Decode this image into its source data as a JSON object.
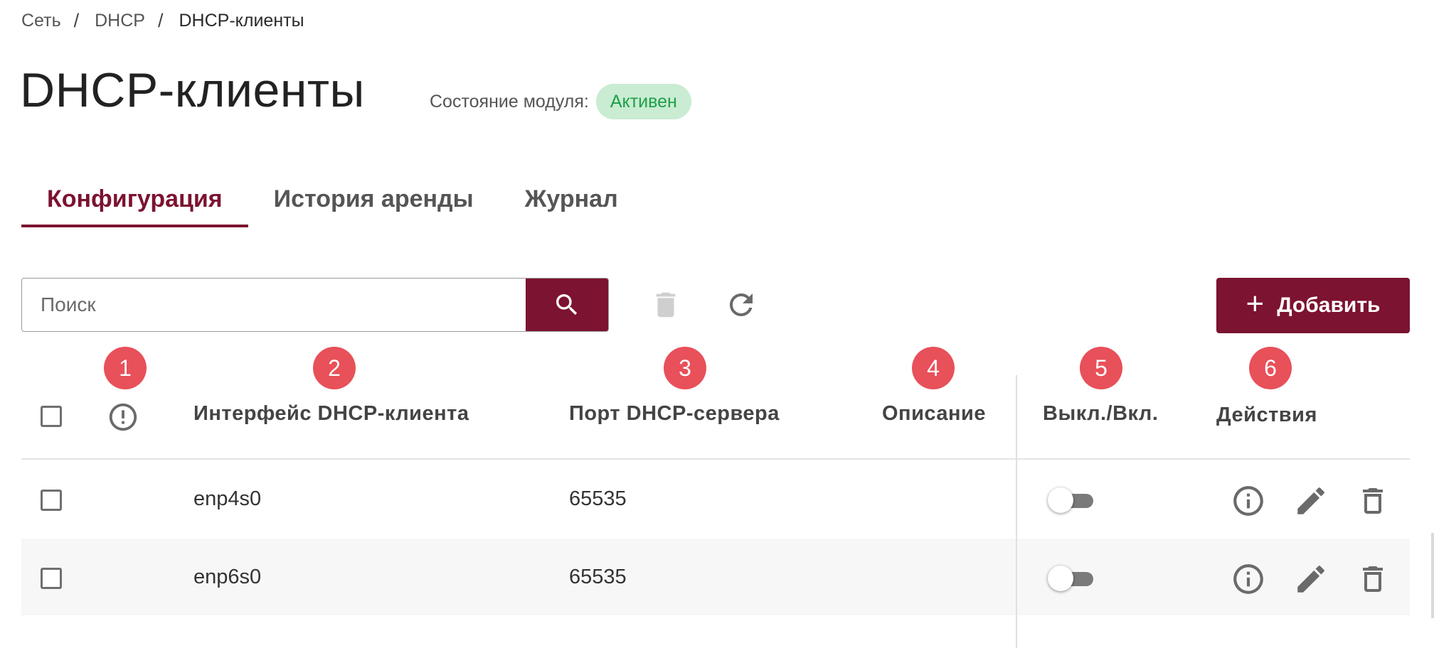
{
  "breadcrumb": {
    "items": [
      "Сеть",
      "DHCP",
      "DHCP-клиенты"
    ],
    "separator": "/"
  },
  "page": {
    "title": "DHCP-клиенты",
    "module_state_label": "Состояние модуля:",
    "module_state_value": "Активен"
  },
  "tabs": [
    {
      "label": "Конфигурация",
      "active": true
    },
    {
      "label": "История аренды",
      "active": false
    },
    {
      "label": "Журнал",
      "active": false
    }
  ],
  "toolbar": {
    "search_placeholder": "Поиск",
    "add_label": "Добавить",
    "search_icon": "search-icon",
    "delete_icon": "trash-icon",
    "refresh_icon": "refresh-icon"
  },
  "markers": [
    "1",
    "2",
    "3",
    "4",
    "5",
    "6"
  ],
  "table": {
    "columns": {
      "status_icon": "alert-circle-icon",
      "interface": "Интерфейс DHCP-клиента",
      "port": "Порт DHCP-сервера",
      "description": "Описание",
      "toggle": "Выкл./Вкл.",
      "actions": "Действия"
    },
    "rows": [
      {
        "interface": "enp4s0",
        "port": "65535",
        "description": "",
        "enabled": false
      },
      {
        "interface": "enp6s0",
        "port": "65535",
        "description": "",
        "enabled": false
      }
    ]
  },
  "colors": {
    "brand": "#7c1330",
    "status_badge_bg": "#c9ecd2",
    "status_badge_text": "#1e9e49",
    "marker": "#e8505a",
    "row_alt": "#f7f7f7"
  }
}
